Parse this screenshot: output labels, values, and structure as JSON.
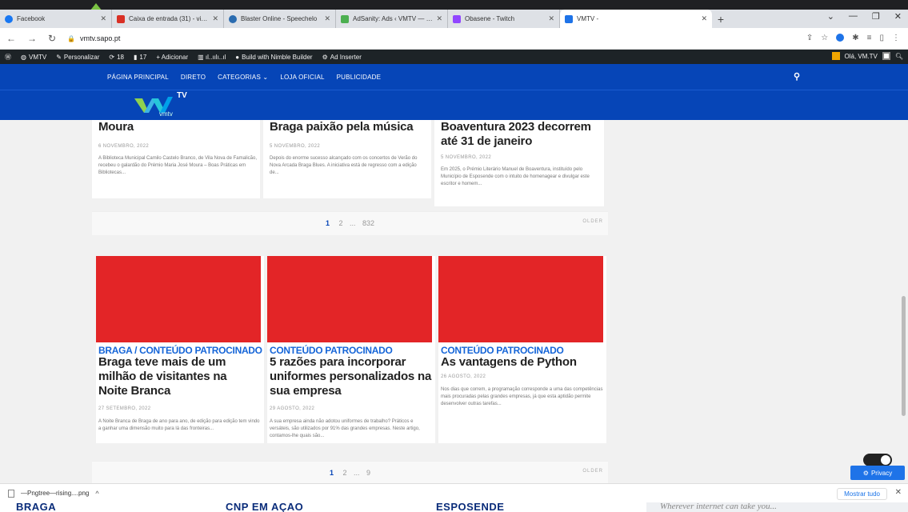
{
  "browser": {
    "tabs": [
      {
        "label": "Facebook",
        "color": "#1877f2"
      },
      {
        "label": "Caixa de entrada (31) - vieiradom",
        "color": "#d93025"
      },
      {
        "label": "Blaster Online - Speechelo",
        "color": "#2b6cb0"
      },
      {
        "label": "AdSanity: Ads ‹ VMTV — WordPr...",
        "color": "#4caf50"
      },
      {
        "label": "Obasene - Twitch",
        "color": "#9146ff"
      },
      {
        "label": "VMTV -",
        "color": "#1e73e8"
      }
    ],
    "url": "vmtv.sapo.pt",
    "new_tab": "+"
  },
  "wpbar": {
    "items": [
      "VMTV",
      "Personalizar",
      "18",
      "17",
      "+ Adicionar",
      "Build with Nimble Builder",
      "Ad Inserter"
    ],
    "greeting": "Olá, VM.TV"
  },
  "nav": {
    "links": [
      "PÁGINA PRINCIPAL",
      "DIRETO",
      "CATEGORIAS ⌄",
      "LOJA OFICIAL",
      "PUBLICIDADE"
    ]
  },
  "logo": {
    "text": "TV",
    "sub": "vmtv"
  },
  "top_posts": [
    {
      "title": "Moura",
      "date": "6 NOVEMBRO, 2022",
      "excerpt": "A Biblioteca Municipal Camilo Castelo Branco, de Vila Nova de Famalicão, recebeu o galardão do Prémio Maria José Moura – Boas Práticas em Bibliotecas..."
    },
    {
      "title": "Braga paixão pela música",
      "date": "5 NOVEMBRO, 2022",
      "excerpt": "Depois do enorme sucesso alcançado com os concertos de Verão do Nova Arcada Braga Blues. A iniciativa está de regresso com a edição de..."
    },
    {
      "title": "Boaventura 2023 decorrem até 31 de janeiro",
      "date": "5 NOVEMBRO, 2022",
      "excerpt": "Em 2025, o Prémio Literário Manuel de Boaventura, instituído pelo Município de Esposende com o intuito de homenagear e divulgar este escritor e homem..."
    }
  ],
  "pager1": {
    "current": "1",
    "next": "2",
    "dots": "...",
    "last": "832",
    "older": "OLDER"
  },
  "sponsored_posts": [
    {
      "category": "BRAGA / CONTEÚDO PATROCINADO",
      "title": "Braga teve mais de um milhão de visitantes na Noite Branca",
      "date": "27 SETEMBRO, 2022",
      "excerpt": "A Noite Branca de Braga de ano para ano, de edição para edição tem vindo a ganhar uma dimensão muito para lá das fronteiras..."
    },
    {
      "category": "CONTEÚDO PATROCINADO",
      "title": "5 razões para incorporar uniformes personalizados na sua empresa",
      "date": "29 AGOSTO, 2022",
      "excerpt": "A sua empresa ainda não adotou uniformes de trabalho? Práticos e versáteis, são utilizados por 91% das grandes empresas. Neste artigo, contamos-lhe quais são..."
    },
    {
      "category": "CONTEÚDO PATROCINADO",
      "title": "As vantagens de Python",
      "date": "26 AGOSTO, 2022",
      "excerpt": "Nos dias que correm, a programação corresponde a uma das competências mais procuradas pelas grandes empresas, já que esta aptidão permite desenvolver outras tarefas..."
    }
  ],
  "pager2": {
    "current": "1",
    "next": "2",
    "dots": "...",
    "last": "9",
    "older": "OLDER"
  },
  "privacy": {
    "label": "Privacy"
  },
  "download": {
    "filename": "—Pngtree—rising....png",
    "show_all": "Mostrar tudo"
  },
  "peek": {
    "items": [
      "BRAGA",
      "CNP EM AÇÃO",
      "ESPOSENDE"
    ],
    "tagline": "Wherever internet can take you..."
  },
  "colors": {
    "brand_blue": "#0645b7",
    "accent_red": "#e32527",
    "category_blue": "#1565d8"
  }
}
